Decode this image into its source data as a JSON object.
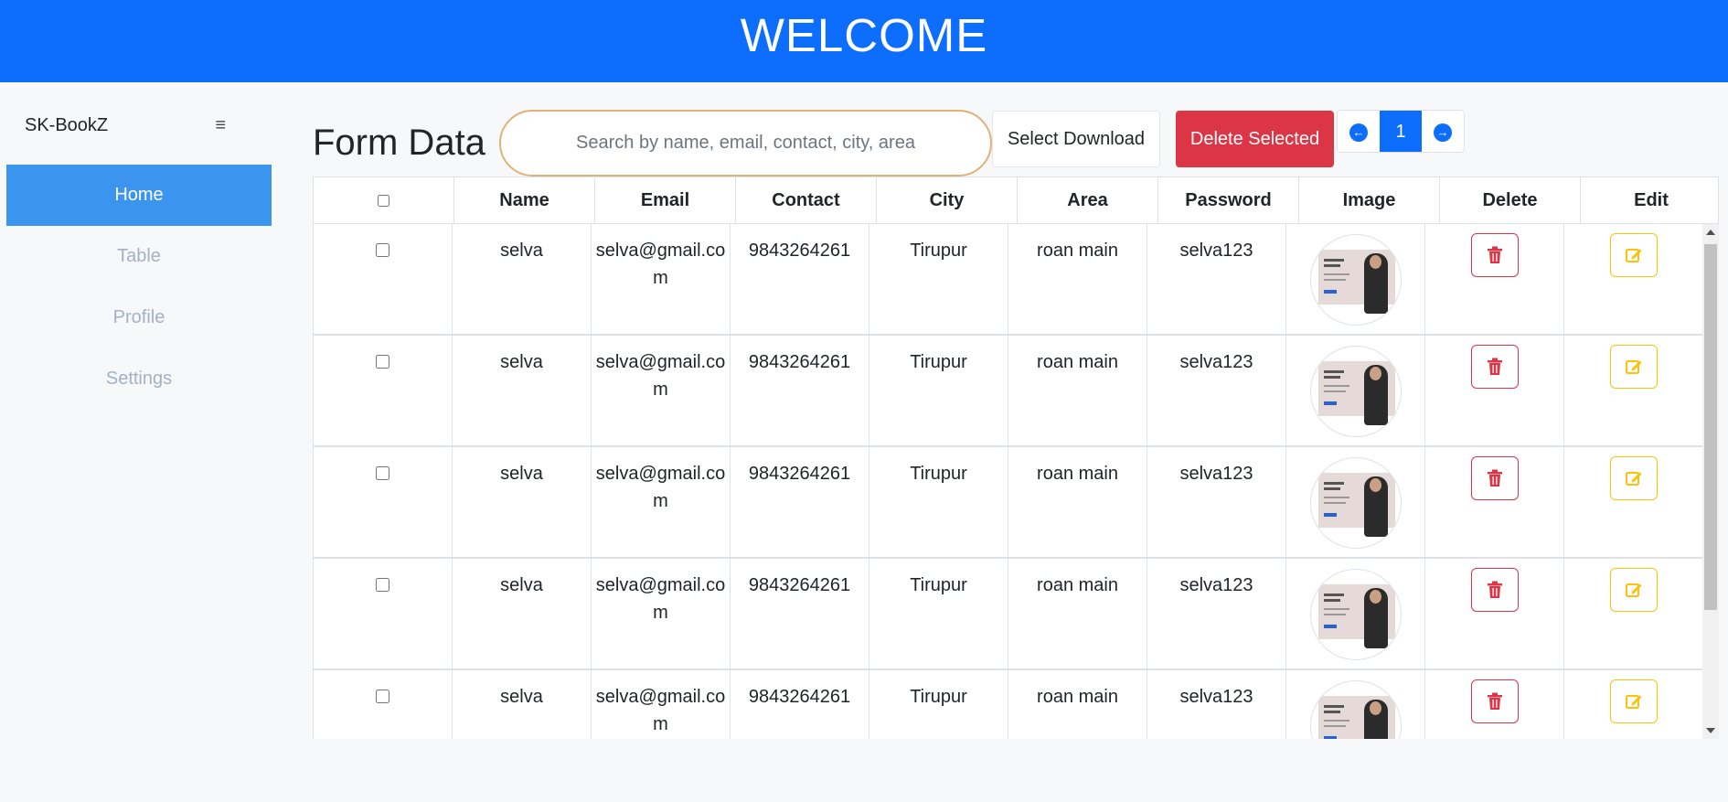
{
  "header": {
    "title": "WELCOME"
  },
  "sidebar": {
    "brand": "SK-BookZ",
    "toggle_icon": "hamburger-icon",
    "items": [
      {
        "label": "Home",
        "active": true
      },
      {
        "label": "Table",
        "active": false
      },
      {
        "label": "Profile",
        "active": false
      },
      {
        "label": "Settings",
        "active": false
      }
    ]
  },
  "main": {
    "title": "Form Data",
    "search": {
      "placeholder": "Search by name, email, contact, city, area",
      "value": ""
    },
    "select_download_label": "Select Download",
    "delete_selected_label": "Delete Selected",
    "pagination": {
      "current_page": "1",
      "prev_icon": "arrow-left-icon",
      "next_icon": "arrow-right-icon"
    }
  },
  "table": {
    "columns": [
      "",
      "Name",
      "Email",
      "Contact",
      "City",
      "Area",
      "Password",
      "Image",
      "Delete",
      "Edit"
    ],
    "rows": [
      {
        "name": "selva",
        "email": "selva@gmail.com",
        "contact": "9843264261",
        "city": "Tirupur",
        "area": "roan main",
        "password": "selva123"
      },
      {
        "name": "selva",
        "email": "selva@gmail.com",
        "contact": "9843264261",
        "city": "Tirupur",
        "area": "roan main",
        "password": "selva123"
      },
      {
        "name": "selva",
        "email": "selva@gmail.com",
        "contact": "9843264261",
        "city": "Tirupur",
        "area": "roan main",
        "password": "selva123"
      },
      {
        "name": "selva",
        "email": "selva@gmail.com",
        "contact": "9843264261",
        "city": "Tirupur",
        "area": "roan main",
        "password": "selva123"
      },
      {
        "name": "selva",
        "email": "selva@gmail.com",
        "contact": "9843264261",
        "city": "Tirupur",
        "area": "roan main",
        "password": "selva123"
      }
    ]
  },
  "colors": {
    "header": "#0d6efd",
    "active_nav": "#3b95ef",
    "danger": "#dc3545",
    "warning": "#ffc107",
    "search_border": "#e0b27a"
  }
}
